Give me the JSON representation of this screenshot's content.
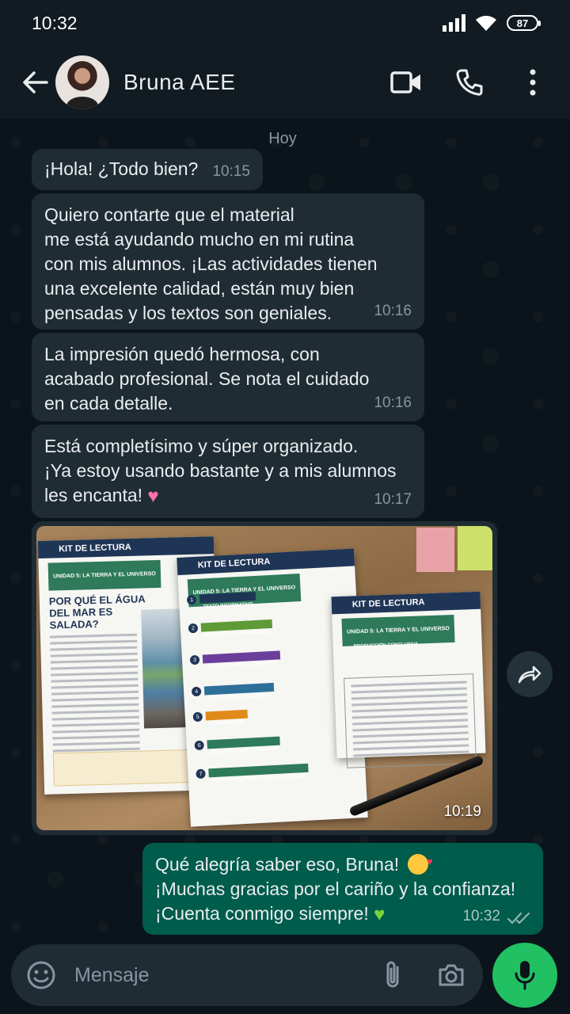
{
  "status_bar": {
    "time": "10:32",
    "battery": "87",
    "icons": [
      "signal-icon",
      "wifi-icon",
      "battery-icon"
    ]
  },
  "header": {
    "contact_name": "Bruna AEE",
    "icons": [
      "back-arrow-icon",
      "video-call-icon",
      "phone-icon",
      "more-vertical-icon"
    ]
  },
  "chat": {
    "day_label": "Hoy",
    "messages": [
      {
        "direction": "in",
        "text": "¡Hola! ¿Todo bien?",
        "time": "10:15"
      },
      {
        "direction": "in",
        "lines": [
          "Quiero contarte que el material",
          "me está ayudando mucho en mi rutina",
          "con mis alumnos. ¡Las actividades tienen",
          "una excelente calidad, están muy bien",
          "pensadas y los textos son geniales."
        ],
        "time": "10:16"
      },
      {
        "direction": "in",
        "lines": [
          "La impresión quedó hermosa, con",
          "acabado profesional. Se nota el cuidado",
          "en cada detalle."
        ],
        "time": "10:16"
      },
      {
        "direction": "in",
        "lines": [
          "Está completísimo y súper organizado.",
          "¡Ya estoy usando bastante y a mis alumnos",
          "les encanta!"
        ],
        "emoji": "♥",
        "time": "10:17"
      },
      {
        "direction": "in",
        "type": "image",
        "time": "10:19",
        "image": {
          "sheet1": {
            "header": "KIT DE LECTURA",
            "unit": "UNIDAD 5: LA TIERRA Y EL UNIVERSO",
            "title": "POR QUÉ EL ÁGUA DEL MAR ES SALADA?"
          },
          "sheet2": {
            "header": "KIT DE LECTURA",
            "unit": "UNIDAD 5: LA TIERRA Y EL UNIVERSO",
            "items": [
              "TEXTO INFORMATIVO",
              "FUNCIÓN Y COMUNICACIÓN",
              "VOCABULARIO EN CONTEXTO",
              "SECUENCIA DE PÁRRAFOS",
              "COMPRENSIÓN",
              "RELACIÓN TEXTO E IMAGEN",
              "METARREFLEXIÓN SOBRE LA LECTURA"
            ]
          },
          "sheet3": {
            "header": "KIT DE LECTURA",
            "unit": "UNIDAD 5: LA TIERRA Y EL UNIVERSO",
            "section": "PRODUCCIÓN CONCLUSIVA"
          }
        }
      },
      {
        "direction": "out",
        "lines": [
          "Qué alegría saber eso, Bruna!",
          "¡Muchas gracias por el cariño y la confianza!",
          "¡Cuenta conmigo siempre!"
        ],
        "time": "10:32",
        "status": "read"
      }
    ]
  },
  "composer": {
    "placeholder": "Mensaje",
    "icons": [
      "emoji-icon",
      "attach-icon",
      "camera-icon",
      "mic-icon"
    ]
  },
  "colors": {
    "background": "#0b141a",
    "bar": "#111b21",
    "incoming_bubble": "#202c33",
    "outgoing_bubble": "#005c4b",
    "accent": "#21c063"
  }
}
